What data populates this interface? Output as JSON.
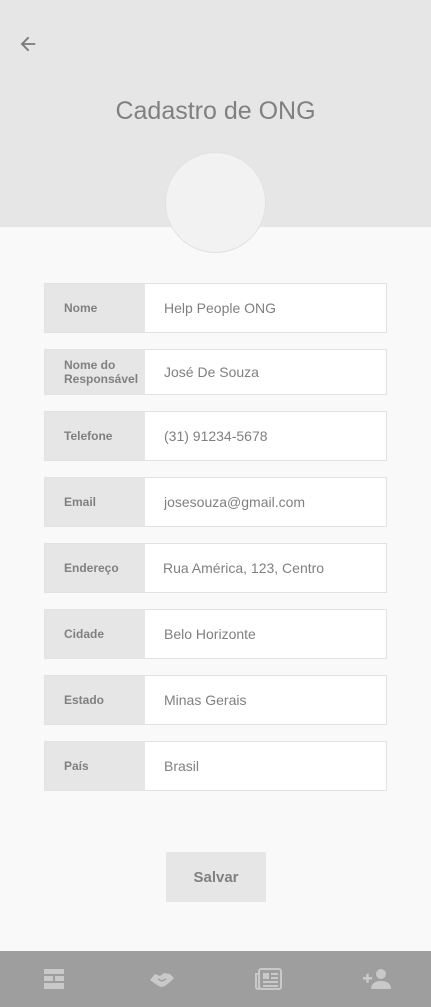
{
  "header": {
    "title": "Cadastro de ONG",
    "back_icon": "arrow-left-icon"
  },
  "form": {
    "fields": [
      {
        "label": "Nome",
        "value": "Help People ONG"
      },
      {
        "label": "Nome do Responsável",
        "value": "José De Souza"
      },
      {
        "label": "Telefone",
        "value": "(31) 91234-5678"
      },
      {
        "label": "Email",
        "value": "josesouza@gmail.com"
      },
      {
        "label": "Endereço",
        "value": "Rua América, 123, Centro"
      },
      {
        "label": "Cidade",
        "value": "Belo Horizonte"
      },
      {
        "label": "Estado",
        "value": "Minas Gerais"
      },
      {
        "label": "País",
        "value": "Brasil"
      }
    ],
    "save_label": "Salvar"
  },
  "bottom_nav": {
    "items": [
      "dashboard-icon",
      "handshake-icon",
      "news-icon",
      "add-user-icon"
    ]
  },
  "colors": {
    "header_bg": "#e6e6e6",
    "page_bg": "#f9f9f9",
    "nav_bg": "#9e9e9e",
    "text": "#808080"
  }
}
